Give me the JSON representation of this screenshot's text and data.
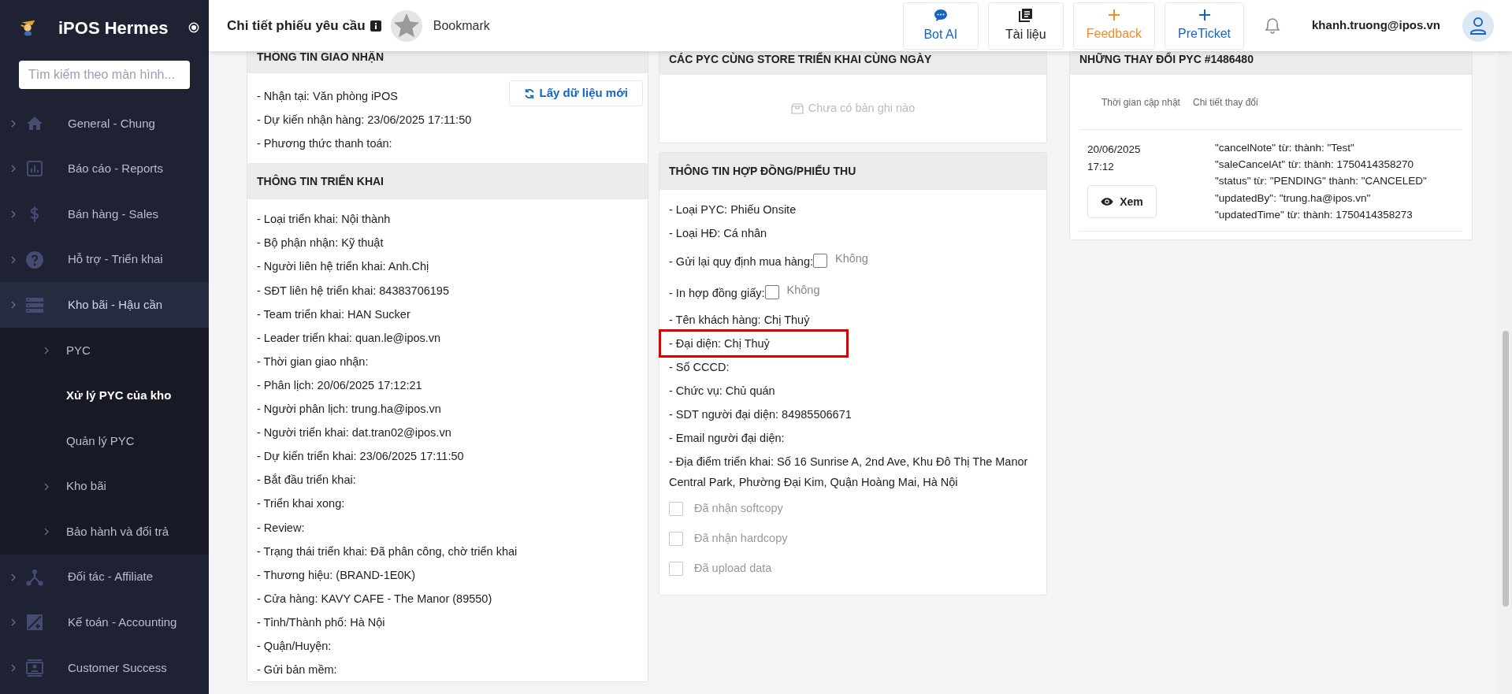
{
  "sidebar": {
    "app_name": "iPOS Hermes",
    "search": {
      "placeholder": "Tìm kiếm theo màn hình..."
    },
    "items": [
      {
        "label": "General - Chung",
        "expanded": false
      },
      {
        "label": "Báo cáo - Reports",
        "expanded": false
      },
      {
        "label": "Bán hàng - Sales",
        "expanded": false
      },
      {
        "label": "Hỗ trợ - Triển khai",
        "expanded": false
      },
      {
        "label": "Kho bãi - Hậu cần",
        "expanded": true,
        "children": [
          {
            "label": "PYC",
            "has_children": true,
            "selected": false
          },
          {
            "label": "Xử lý PYC của kho",
            "has_children": false,
            "selected": true
          },
          {
            "label": "Quản lý PYC",
            "has_children": false,
            "selected": false
          },
          {
            "label": "Kho bãi",
            "has_children": true,
            "selected": false
          },
          {
            "label": "Bảo hành và đổi trả",
            "has_children": true,
            "selected": false
          }
        ]
      },
      {
        "label": "Đối tác - Affiliate",
        "expanded": false
      },
      {
        "label": "Kế toán - Accounting",
        "expanded": false
      },
      {
        "label": "Customer Success",
        "expanded": false
      }
    ]
  },
  "header": {
    "title": "Chi tiết phiếu yêu cầu",
    "bookmark": "Bookmark",
    "buttons": [
      {
        "label": "Bot AI",
        "kind": "chat",
        "color": "#1565c0"
      },
      {
        "label": "Tài liệu",
        "kind": "book",
        "color": "#222222"
      },
      {
        "label": "Feedback",
        "kind": "plus",
        "color": "#f28c28"
      },
      {
        "label": "PreTicket",
        "kind": "plus",
        "color": "#1565c0"
      }
    ],
    "user": "khanh.truong@ipos.vn"
  },
  "left_sections": [
    {
      "title": "THÔNG TIN GIAO NHẬN",
      "button": "Lấy dữ liệu mới",
      "lines": [
        "- Nhận tại: Văn phòng iPOS",
        "- Dự kiến nhận hàng: 23/06/2025 17:11:50",
        "- Phương thức thanh toán:"
      ]
    },
    {
      "title": "THÔNG TIN TRIỂN KHAI",
      "lines": [
        "- Loại triển khai: Nội thành",
        "- Bộ phận nhận: Kỹ thuật",
        "- Người liên hệ triển khai: Anh.Chị",
        "- SĐT liên hệ triển khai: 84383706195",
        "- Team triển khai: HAN Sucker",
        "- Leader triển khai: quan.le@ipos.vn",
        "- Thời gian giao nhận:",
        "- Phân lịch: 20/06/2025 17:12:21",
        "- Người phân lịch: trung.ha@ipos.vn",
        "- Người triển khai: dat.tran02@ipos.vn",
        "- Dự kiến triển khai: 23/06/2025 17:11:50",
        "- Bắt đầu triển khai:",
        "- Triển khai xong:",
        "- Review:",
        "- Trạng thái triển khai: Đã phân công, chờ triển khai",
        "- Thương hiệu: (BRAND-1E0K)",
        "- Cửa hàng: KAVY CAFE - The Manor (89550)",
        "- Tỉnh/Thành phố: Hà Nội",
        "- Quận/Huyện:",
        "- Gửi bản mềm:"
      ]
    }
  ],
  "same_day": {
    "title": "CÁC PYC CÙNG STORE TRIỂN KHAI CÙNG NGÀY",
    "empty": "Chưa có bản ghi nào"
  },
  "contract": {
    "title": "THÔNG TIN HỢP ĐỒNG/PHIẾU THU",
    "rows": [
      {
        "kind": "text",
        "text": "- Loại PYC: Phiếu Onsite",
        "highlighted": false
      },
      {
        "kind": "text",
        "text": "- Loại HĐ: Cá nhân",
        "highlighted": false
      },
      {
        "kind": "inline_check",
        "text": "- Gửi lại quy định mua hàng:",
        "value": "Không",
        "checked": false
      },
      {
        "kind": "inline_check",
        "text": "- In hợp đồng giấy:",
        "value": "Không",
        "checked": false
      },
      {
        "kind": "text",
        "text": "- Tên khách hàng: Chị Thuỷ",
        "highlighted": false
      },
      {
        "kind": "text",
        "text": "- Đại diện: Chị Thuỷ",
        "highlighted": true
      },
      {
        "kind": "text",
        "text": "- Số CCCD:",
        "highlighted": false
      },
      {
        "kind": "text",
        "text": "- Chức vụ: Chủ quán",
        "highlighted": false
      },
      {
        "kind": "text",
        "text": "- SDT người đại diện: 84985506671",
        "highlighted": false
      },
      {
        "kind": "text",
        "text": "- Email người đại diện:",
        "highlighted": false
      },
      {
        "kind": "text",
        "text": "- Địa điểm triển khai: Số 16 Sunrise A, 2nd Ave, Khu Đô Thị The Manor Central Park, Phường Đại Kim, Quận Hoàng Mai, Hà Nội",
        "highlighted": false
      },
      {
        "kind": "checkbox",
        "text": "Đã nhận softcopy",
        "checked": false,
        "disabled": true
      },
      {
        "kind": "checkbox",
        "text": "Đã nhận hardcopy",
        "checked": false,
        "disabled": true
      },
      {
        "kind": "checkbox",
        "text": "Đã upload data",
        "checked": false,
        "disabled": true
      }
    ]
  },
  "changes": {
    "title": "NHỮNG THAY ĐỔI PYC #1486480",
    "columns": [
      "Thời gian cập nhật",
      "Chi tiết thay đổi"
    ],
    "rows": [
      {
        "date": "20/06/2025",
        "time": "17:12",
        "button": "Xem",
        "details": [
          "\"cancelNote\" từ: thành: \"Test\"",
          "\"saleCancelAt\" từ: thành: 1750414358270",
          "\"status\" từ: \"PENDING\" thành: \"CANCELED\"",
          "\"updatedBy\": \"trung.ha@ipos.vn\"",
          "\"updatedTime\" từ: thành: 1750414358273"
        ]
      }
    ]
  }
}
